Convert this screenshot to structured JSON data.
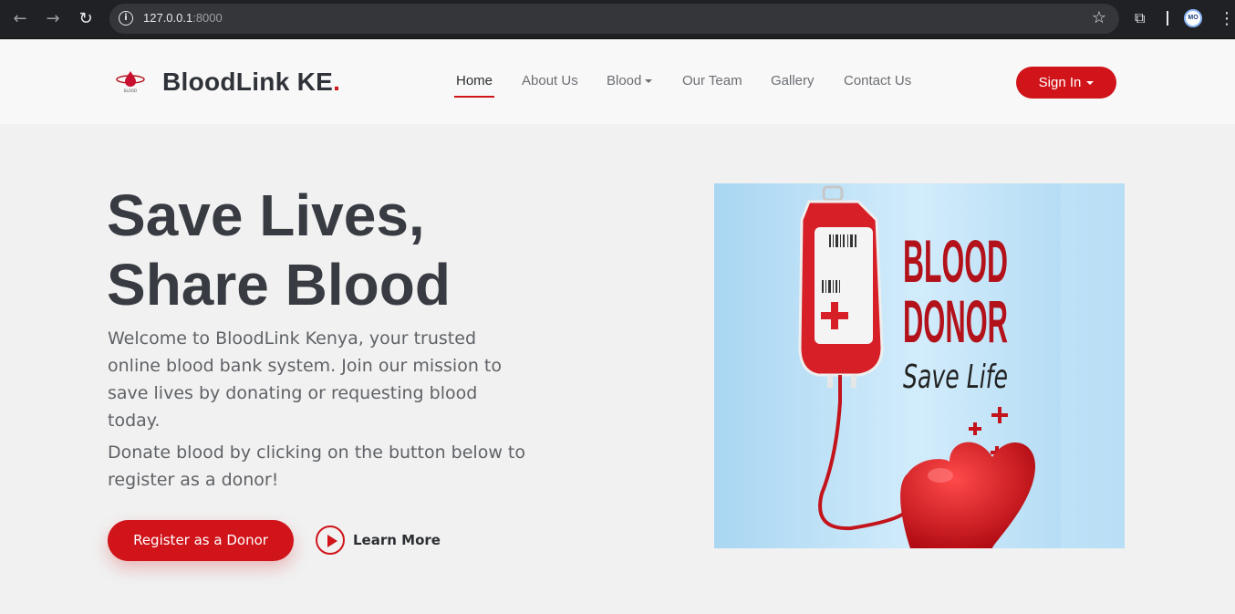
{
  "browser": {
    "url_host": "127.0.0.1",
    "url_port": ":8000",
    "profile_initials": "MO"
  },
  "header": {
    "brand_name": "BloodLink KE",
    "brand_dot": ".",
    "logo_text": "BLOOD",
    "nav": [
      {
        "label": "Home",
        "active": true
      },
      {
        "label": "About Us"
      },
      {
        "label": "Blood",
        "dropdown": true
      },
      {
        "label": "Our Team"
      },
      {
        "label": "Gallery"
      },
      {
        "label": "Contact Us"
      }
    ],
    "signin_label": "Sign In"
  },
  "hero": {
    "title_line1": "Save Lives,",
    "title_line2": "Share Blood",
    "intro": "Welcome to BloodLink Kenya, your trusted online blood bank system. Join our mission to save lives by donating or requesting blood today.",
    "cta_text": "Donate blood by clicking on the button below to register as a donor!",
    "register_button": "Register as a Donor",
    "learn_more": "Learn More",
    "image": {
      "line1": "BLOOD",
      "line2": "DONOR",
      "line3": "Save Life"
    }
  },
  "colors": {
    "accent": "#d0141a",
    "text_dark": "#383b42",
    "text_muted": "#5f6266",
    "hero_bg": "#f1f1f1",
    "header_bg": "#f8f8f8",
    "image_bg": "#bfe1f5"
  }
}
